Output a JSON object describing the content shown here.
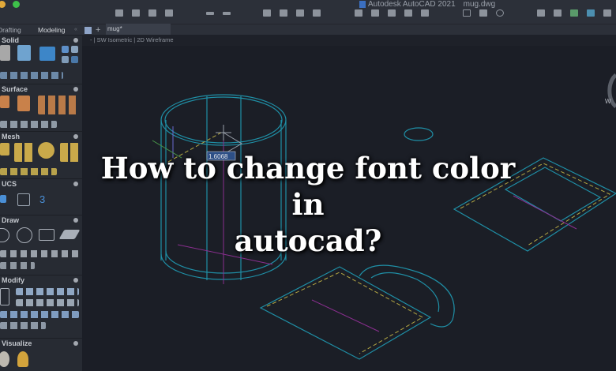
{
  "window": {
    "app_title": "Autodesk AutoCAD 2021",
    "file_name": "mug.dwg"
  },
  "palette_tabs": [
    "Drafting",
    "Modeling"
  ],
  "file_tab": "mug*",
  "viewport_label": "- | SW Isometric | 2D Wireframe",
  "palette_sections": [
    "Solid",
    "Surface",
    "Mesh",
    "UCS",
    "Draw",
    "Modify",
    "Visualize"
  ],
  "dimension_value": "1.6068",
  "viewcube_label": "W",
  "headline": {
    "line1": "How to change font color in",
    "line2": "autocad?"
  },
  "colors": {
    "cyan": "#1f8fa6",
    "magenta": "#8a2f8f",
    "yellow": "#b5a944",
    "accent": "#4a8fd6"
  }
}
